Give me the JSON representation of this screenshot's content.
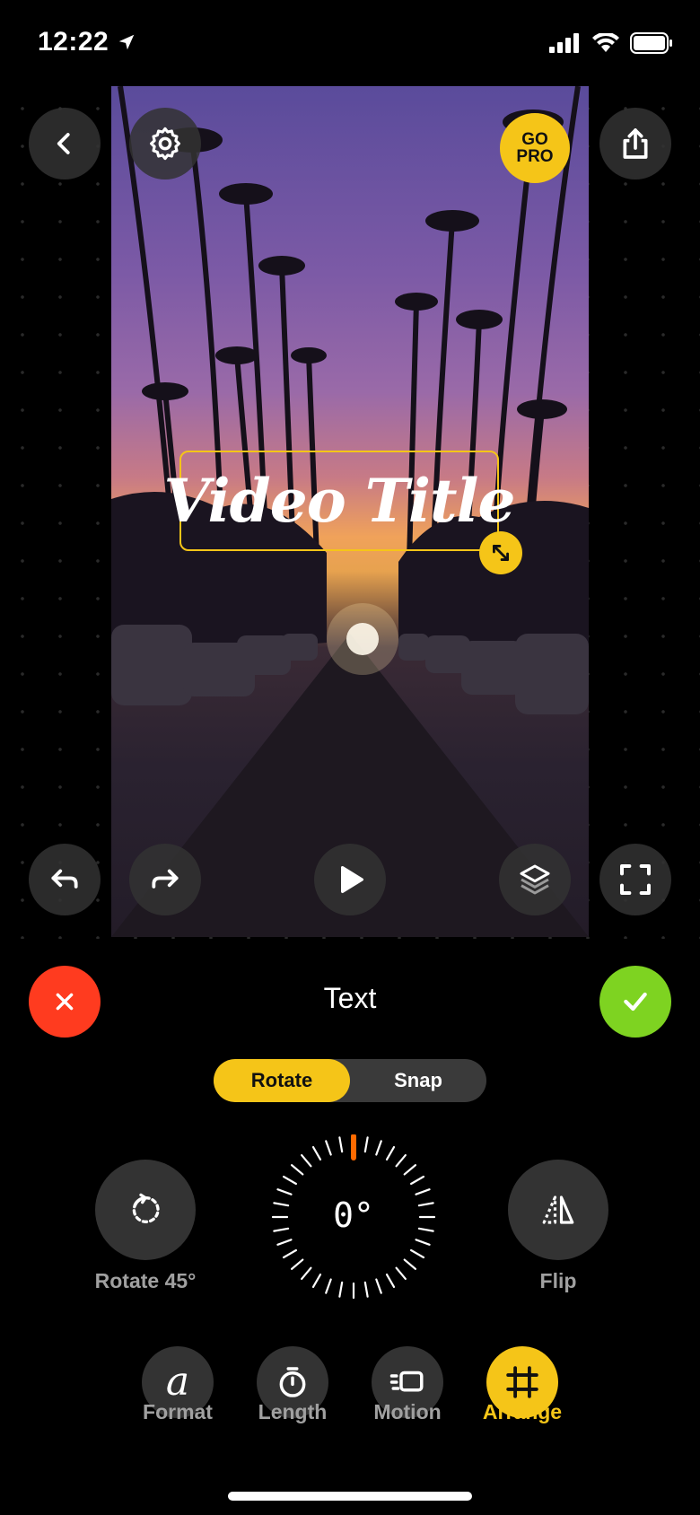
{
  "status_bar": {
    "time": "12:22"
  },
  "preview": {
    "title_text": "Video Title",
    "go_pro_line1": "GO",
    "go_pro_line2": "PRO"
  },
  "panel": {
    "title": "Text",
    "segments": [
      "Rotate",
      "Snap"
    ],
    "active_segment": "Rotate",
    "rotate45_label": "Rotate 45°",
    "flip_label": "Flip",
    "dial_value": "0°"
  },
  "tools": [
    {
      "label": "Format",
      "icon": "format-a-icon",
      "active": false
    },
    {
      "label": "Length",
      "icon": "timer-icon",
      "active": false
    },
    {
      "label": "Motion",
      "icon": "motion-icon",
      "active": false
    },
    {
      "label": "Arrange",
      "icon": "crop-frame-icon",
      "active": true
    }
  ],
  "colors": {
    "accent": "#f5c518",
    "cancel": "#ff3b1f",
    "confirm": "#7ed321",
    "dial_marker": "#ff6a00"
  }
}
